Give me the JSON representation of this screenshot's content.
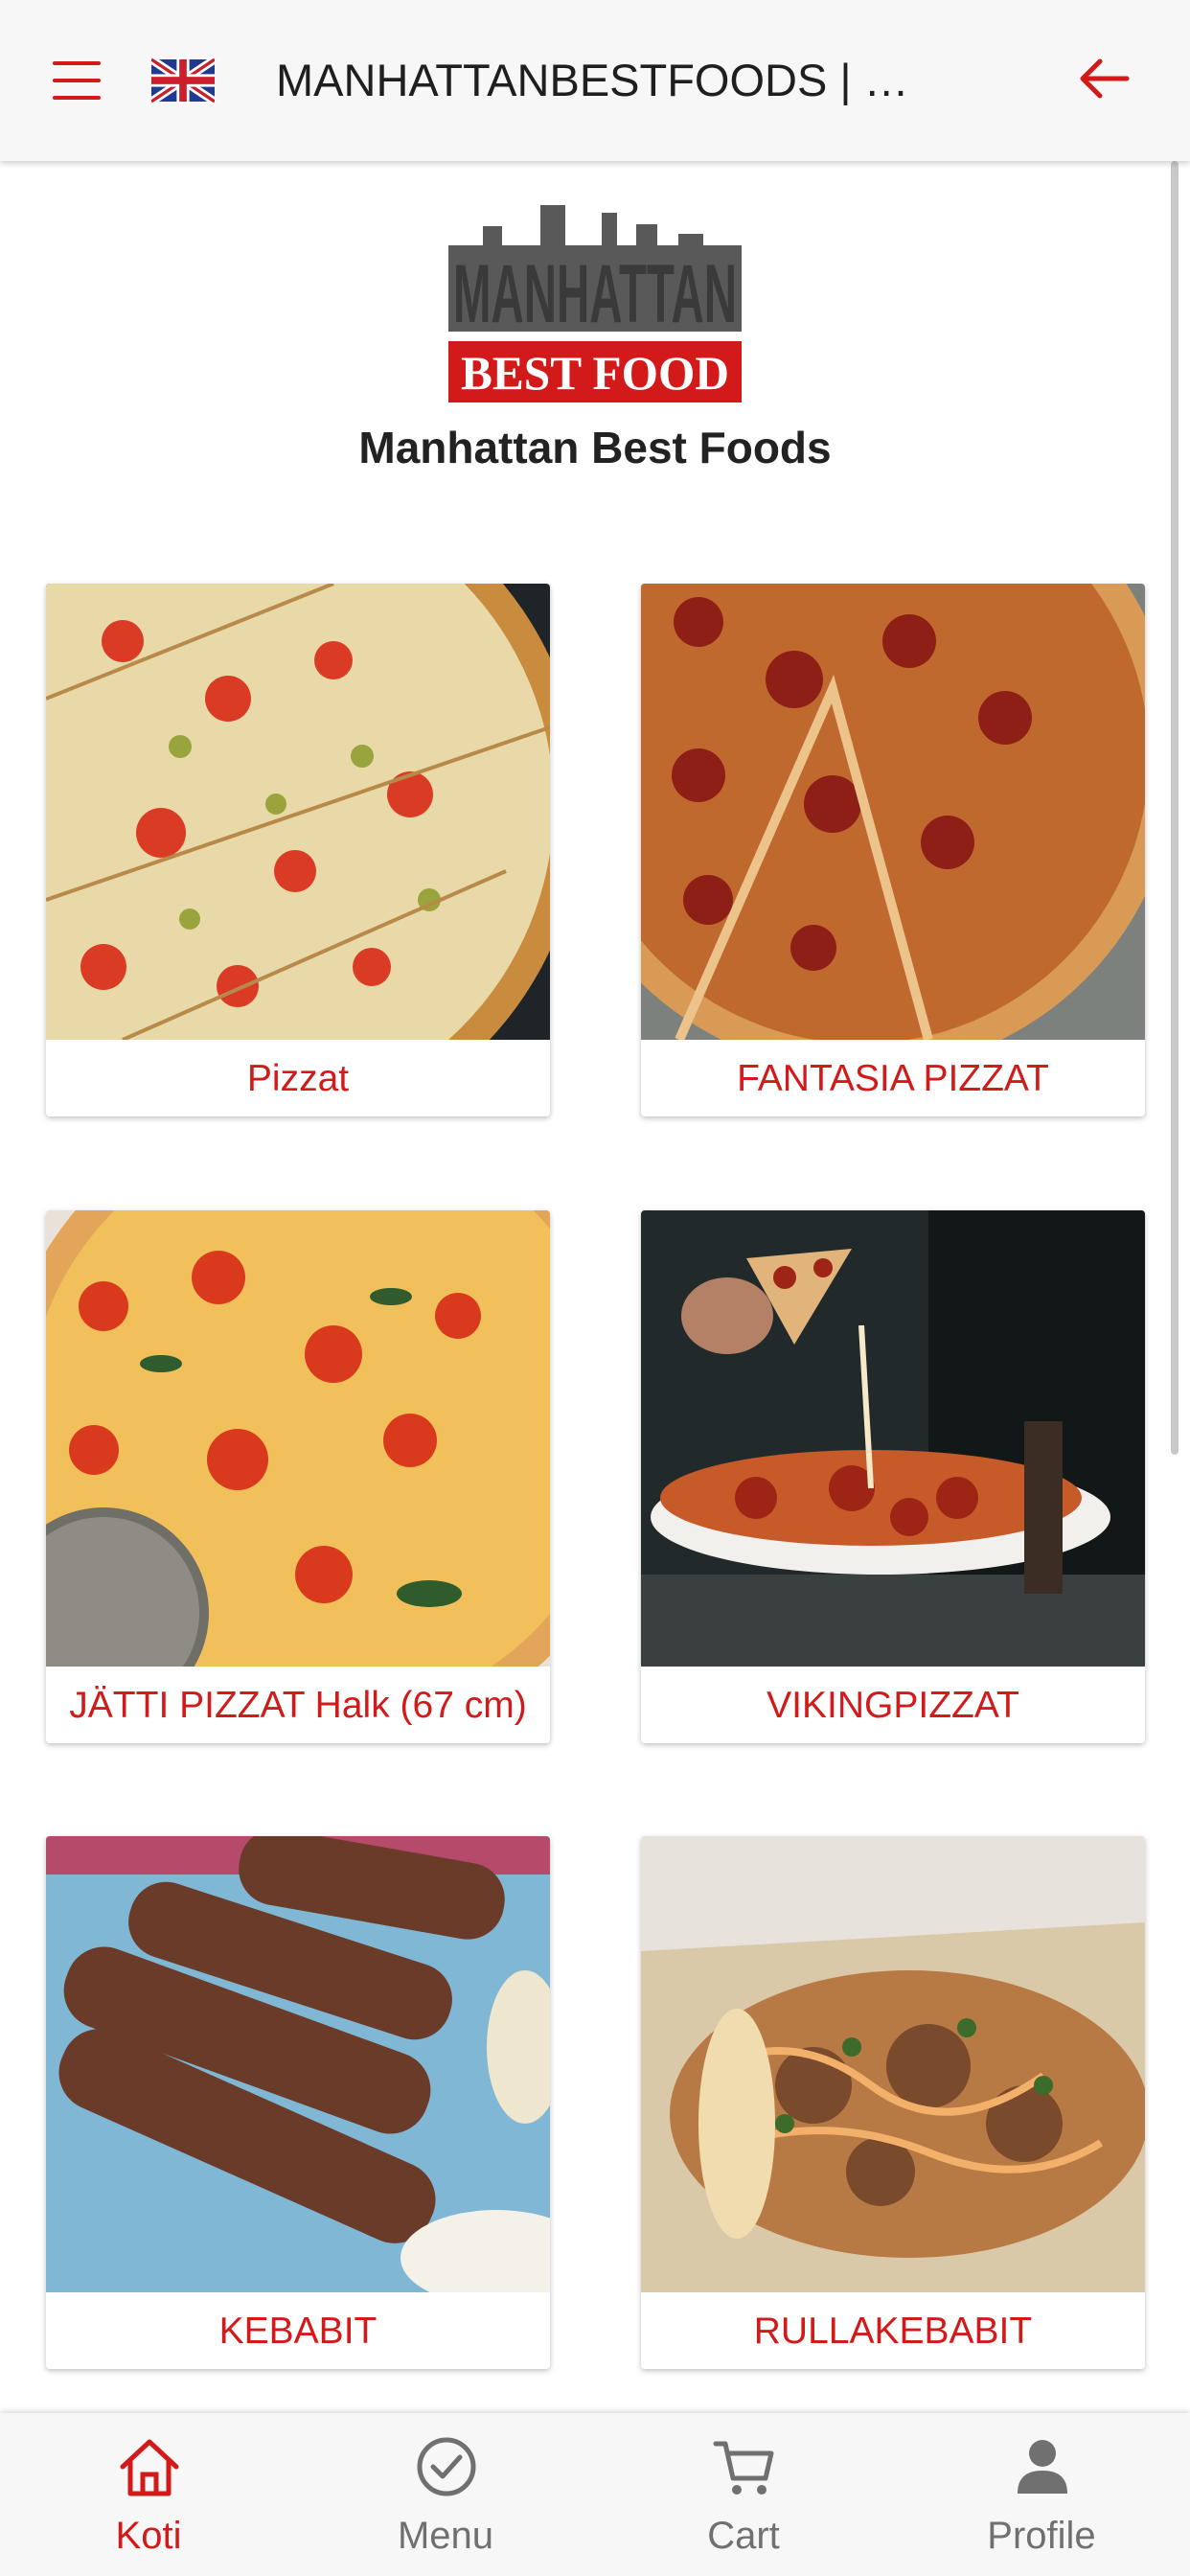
{
  "header": {
    "title": "MANHATTANBESTFOODS | …",
    "menu_icon": "hamburger-icon",
    "language_icon": "uk-flag-icon",
    "back_icon": "arrow-left-icon"
  },
  "store": {
    "name": "Manhattan Best Foods",
    "logo_text_top": "MANHATTAN",
    "logo_text_bottom": "BEST FOOD"
  },
  "categories": [
    {
      "label": "Pizzat",
      "image": "pizza-olive-tomato-image"
    },
    {
      "label": "FANTASIA PIZZAT",
      "image": "pepperoni-pizza-image"
    },
    {
      "label": "JÄTTI PIZZAT Halk (67 cm)",
      "image": "margherita-pizza-image"
    },
    {
      "label": "VIKINGPIZZAT",
      "image": "pizza-slice-lift-image"
    },
    {
      "label": "KEBABIT",
      "image": "kebab-skewers-image"
    },
    {
      "label": "RULLAKEBABIT",
      "image": "kebab-roll-box-image"
    }
  ],
  "bottom_nav": [
    {
      "label": "Koti",
      "icon": "home-icon",
      "active": true
    },
    {
      "label": "Menu",
      "icon": "check-circle-icon",
      "active": false
    },
    {
      "label": "Cart",
      "icon": "cart-icon",
      "active": false
    },
    {
      "label": "Profile",
      "icon": "person-icon",
      "active": false
    }
  ],
  "colors": {
    "accent": "#d31a1a",
    "header_bg": "#f7f7f7",
    "nav_inactive": "#707070"
  }
}
